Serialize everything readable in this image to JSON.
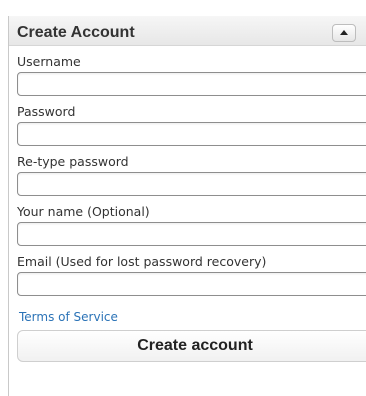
{
  "panel": {
    "title": "Create Account",
    "collapse_icon": "chevron-up-icon"
  },
  "form": {
    "username_label": "Username",
    "username_value": "",
    "password_label": "Password",
    "password_value": "",
    "retype_label": "Re-type password",
    "retype_value": "",
    "name_label": "Your name (Optional)",
    "name_value": "",
    "email_label": "Email (Used for lost password recovery)",
    "email_value": "",
    "tos_link": "Terms of Service",
    "submit_label": "Create account"
  },
  "colors": {
    "link": "#2b73b7",
    "border": "#8e8e8e",
    "header_bg": "#eeeeee"
  }
}
